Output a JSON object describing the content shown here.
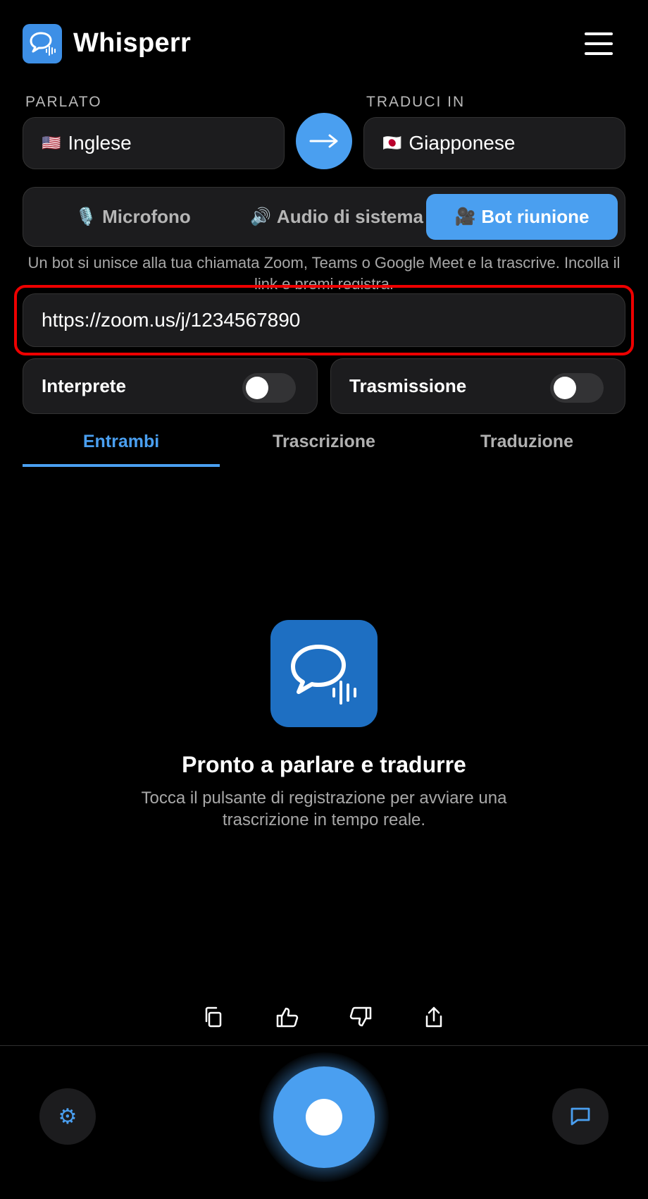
{
  "app": {
    "title": "Whisperr"
  },
  "languages": {
    "source_label": "PARLATO",
    "target_label": "TRADUCI IN",
    "source": {
      "flag": "🇺🇸",
      "name": "Inglese"
    },
    "target": {
      "flag": "🇯🇵",
      "name": "Giapponese"
    },
    "swap_symbol": "→"
  },
  "source_modes": [
    {
      "icon": "🎙️",
      "label": "Microfono",
      "active": false
    },
    {
      "icon": "🔊",
      "label": "Audio di sistema",
      "active": false
    },
    {
      "icon": "🎥",
      "label": "Bot riunione",
      "active": true
    }
  ],
  "info_text": "Un bot si unisce alla tua chiamata Zoom, Teams o Google Meet e la trascrive. Incolla il link e premi registra.",
  "meeting_url": {
    "value": "https://zoom.us/j/1234567890",
    "placeholder": ""
  },
  "toggles": [
    {
      "label": "Interprete",
      "on": false
    },
    {
      "label": "Trasmissione",
      "on": false
    }
  ],
  "tabs": [
    {
      "label": "Entrambi",
      "active": true
    },
    {
      "label": "Trascrizione",
      "active": false
    },
    {
      "label": "Traduzione",
      "active": false
    }
  ],
  "empty_state": {
    "title": "Pronto a parlare e tradurre",
    "subtitle": "Tocca il pulsante di registrazione per avviare una trascrizione in tempo reale."
  },
  "actions": [
    "copy-icon",
    "thumbs-up-icon",
    "thumbs-down-icon",
    "share-icon"
  ],
  "bottom_bar": {
    "settings_icon": "⚙"
  },
  "colors": {
    "accent": "#4a9ff0",
    "highlight": "#e00000",
    "surface": "#1c1c1e",
    "background": "#000000"
  }
}
